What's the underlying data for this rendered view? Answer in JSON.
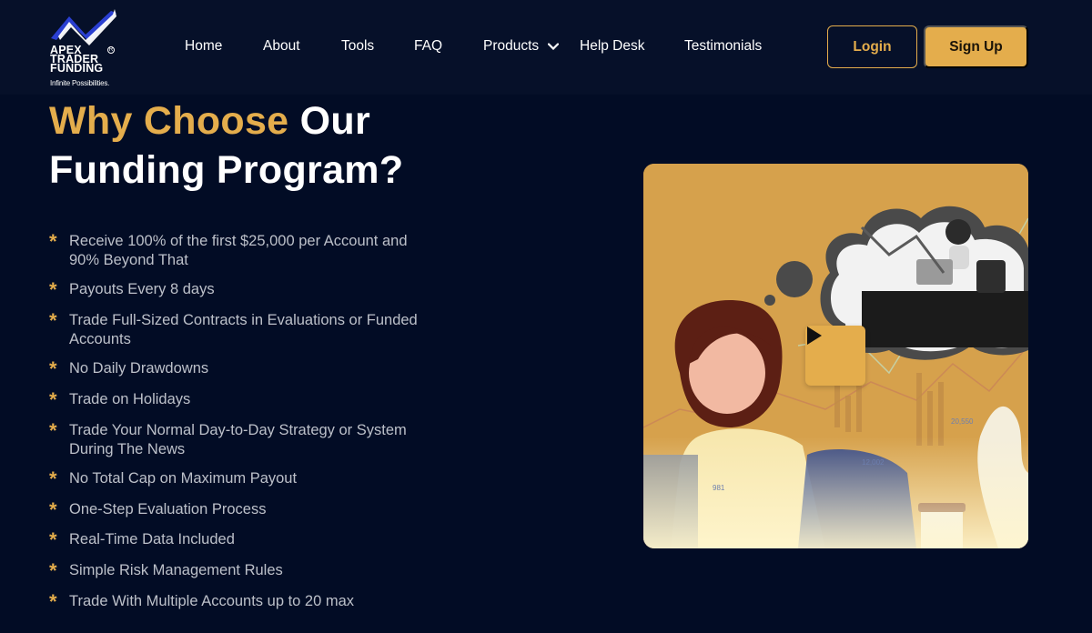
{
  "brand": {
    "line1": "APEX",
    "line2": "TRADER",
    "line3": "FUNDING",
    "registered": "R",
    "tagline": "Infinite Possibilities."
  },
  "nav": {
    "home": "Home",
    "about": "About",
    "tools": "Tools",
    "faq": "FAQ",
    "products": "Products",
    "help": "Help Desk",
    "testimonials": "Testimonials"
  },
  "auth": {
    "login": "Login",
    "signup": "Sign Up"
  },
  "hero": {
    "title_accent": "Why Choose",
    "title_rest_1": "Our",
    "title_rest_2": "Funding Program?"
  },
  "features": [
    "Receive 100% of the first $25,000 per Account and 90% Beyond That",
    "Payouts Every 8 days",
    "Trade Full-Sized Contracts in Evaluations or Funded Accounts",
    "No Daily Drawdowns",
    "Trade on Holidays",
    "Trade Your Normal Day-to-Day Strategy or System During The News",
    "No Total Cap on Maximum Payout",
    "One-Step Evaluation Process",
    "Real-Time Data Included",
    "Simple Risk Management Rules",
    "Trade With Multiple Accounts up to 20 max"
  ],
  "video": {
    "label_a": "20,550",
    "label_b": "12,002",
    "label_c": "981"
  },
  "colors": {
    "background": "#020c25",
    "header": "#061029",
    "accent": "#e4ad4c",
    "text_muted": "#bcc0c9"
  },
  "icons": {
    "bullet": "asterisk-icon",
    "products_caret": "chevron-down-icon",
    "video": "play-icon"
  }
}
